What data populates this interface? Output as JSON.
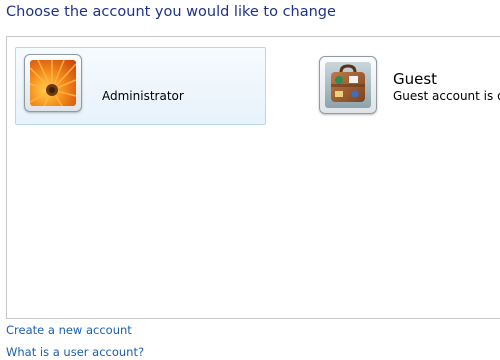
{
  "header": {
    "title": "Choose the account you would like to change"
  },
  "accounts": [
    {
      "name": "Administrator",
      "selected": true,
      "avatar": "orange-flower-avatar"
    },
    {
      "name": "Guest",
      "status": "Guest account is off",
      "selected": false,
      "avatar": "suitcase-avatar"
    }
  ],
  "links": {
    "create": "Create a new account",
    "what": "What is a user account?"
  },
  "colors": {
    "title": "#1e3287",
    "link": "#1b5fb0",
    "selection_border": "#b7d7f0",
    "selection_fill": "#e7f2fb"
  }
}
